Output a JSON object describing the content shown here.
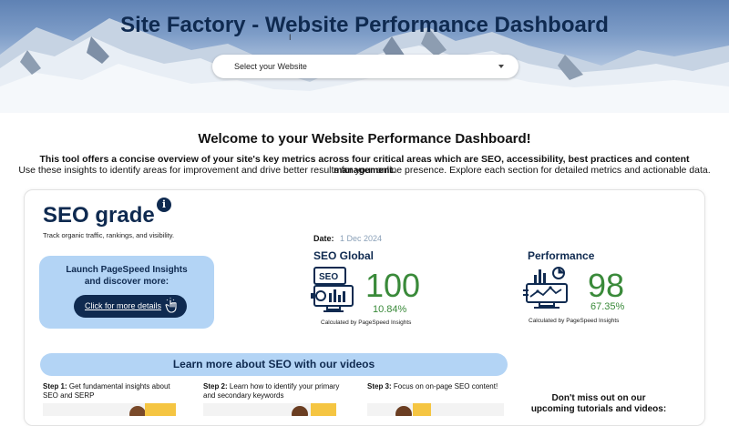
{
  "header": {
    "title": "Site Factory - Website Performance Dashboard",
    "select_placeholder": "Select your Website"
  },
  "welcome": {
    "heading": "Welcome to your Website Performance Dashboard!",
    "line1": "This tool offers a concise overview of your site's key metrics across four critical areas which are SEO, accessibility, best practices and content management.",
    "line2": "Use these insights to identify areas for improvement and drive better results for your online presence. Explore each section for detailed metrics and actionable data."
  },
  "seo_section": {
    "title": "SEO grade",
    "info_glyph": "i",
    "subtitle": "Track organic traffic, rankings, and visibility.",
    "launch_line1": "Launch PageSpeed Insights",
    "launch_line2": "and discover more:",
    "more_button": "Click for more details",
    "date_label": "Date:",
    "date_value": "1 Dec 2024",
    "global": {
      "title": "SEO Global",
      "score": "100",
      "percent": "10.84%",
      "caption": "Calculated by PageSpeed Insights",
      "icon_text": "SEO"
    },
    "performance": {
      "title": "Performance",
      "score": "98",
      "percent": "67.35%",
      "caption": "Calculated by PageSpeed Insights"
    }
  },
  "videos": {
    "banner": "Learn more about SEO with our videos",
    "steps": [
      {
        "label": "Step 1:",
        "text": " Get fundamental insights about SEO and SERP"
      },
      {
        "label": "Step 2:",
        "text": " Learn how to identify your primary and secondary keywords"
      },
      {
        "label": "Step 3:",
        "text": " Focus on on-page SEO content!"
      }
    ],
    "upcoming": "Don't miss out on our upcoming tutorials and videos:"
  },
  "colors": {
    "navy": "#0f2a50",
    "light_blue": "#b3d4f5",
    "green": "#3a8a3a"
  }
}
